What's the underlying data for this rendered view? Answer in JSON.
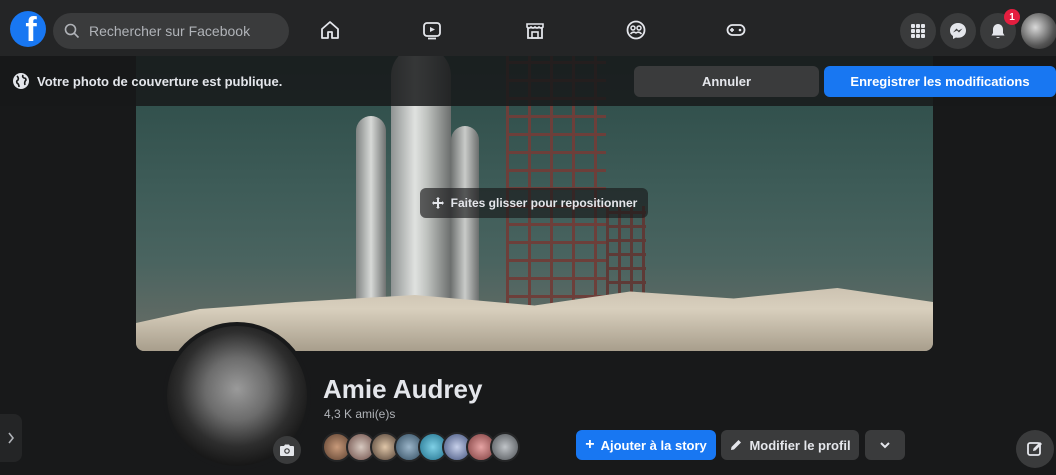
{
  "search": {
    "placeholder": "Rechercher sur Facebook"
  },
  "nav": {
    "icons": [
      "home-icon",
      "watch-icon",
      "marketplace-icon",
      "groups-icon",
      "gaming-icon"
    ]
  },
  "top_right": {
    "notification_count": "1"
  },
  "cover_bar": {
    "public_notice": "Votre photo de couverture est publique.",
    "cancel_label": "Annuler",
    "save_label": "Enregistrer les modifications"
  },
  "cover": {
    "drag_hint": "Faites glisser pour repositionner"
  },
  "profile": {
    "name": "Amie Audrey",
    "friends_count": "4,3 K ami(e)s",
    "add_story_label": "Ajouter à la story",
    "edit_profile_label": "Modifier le profil"
  },
  "colors": {
    "accent": "#1877f2",
    "background": "#18191a",
    "surface": "#242526",
    "button": "#3a3b3c",
    "badge": "#e41e3f"
  }
}
